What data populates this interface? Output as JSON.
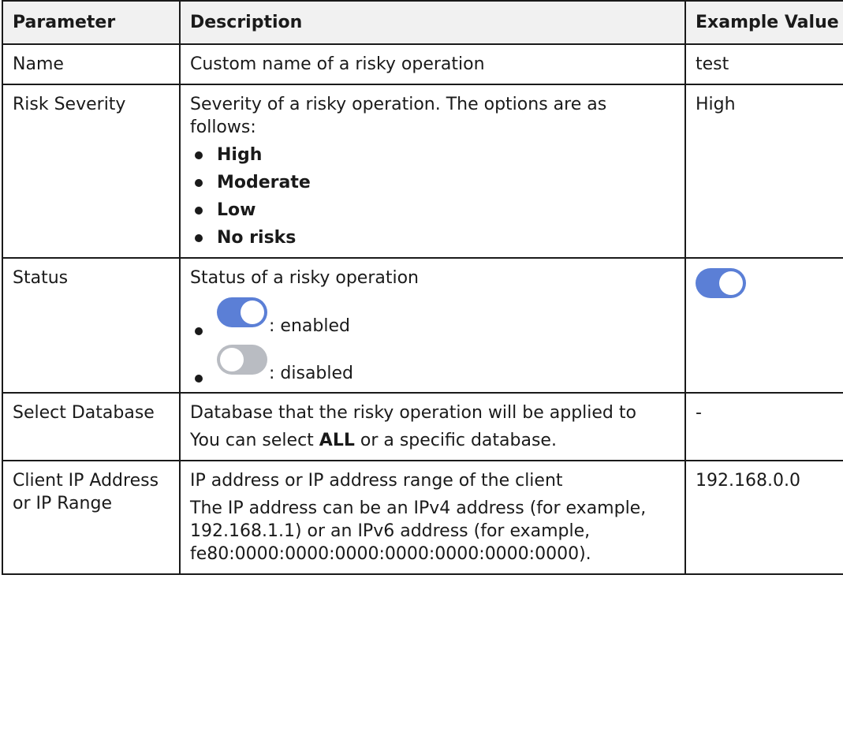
{
  "headers": {
    "parameter": "Parameter",
    "description": "Description",
    "example": "Example Value"
  },
  "rows": {
    "name": {
      "parameter": "Name",
      "description": "Custom name of a risky operation",
      "example": "test"
    },
    "risk_severity": {
      "parameter": "Risk Severity",
      "description": "Severity of a risky operation. The options are as follows:",
      "options": [
        "High",
        "Moderate",
        "Low",
        "No risks"
      ],
      "example": "High"
    },
    "status": {
      "parameter": "Status",
      "description": "Status of a risky operation",
      "enabled_label": ": enabled",
      "disabled_label": ": disabled",
      "example_state": "enabled",
      "colors": {
        "on": "#5b7fd6",
        "off": "#b9bcc2"
      }
    },
    "select_database": {
      "parameter": "Select Database",
      "description_1": "Database that the risky operation will be applied to",
      "description_2_before": "You can select ",
      "description_2_bold": "ALL",
      "description_2_after": " or a specific database.",
      "example": "-"
    },
    "client_ip": {
      "parameter": "Client IP Address or IP Range",
      "description_1": "IP address or IP address range of the client",
      "description_2": "The IP address can be an IPv4 address (for example, 192.168.1.1) or an IPv6 address (for example, fe80:0000:0000:0000:0000:0000:0000:0000).",
      "example": "192.168.0.0"
    }
  }
}
